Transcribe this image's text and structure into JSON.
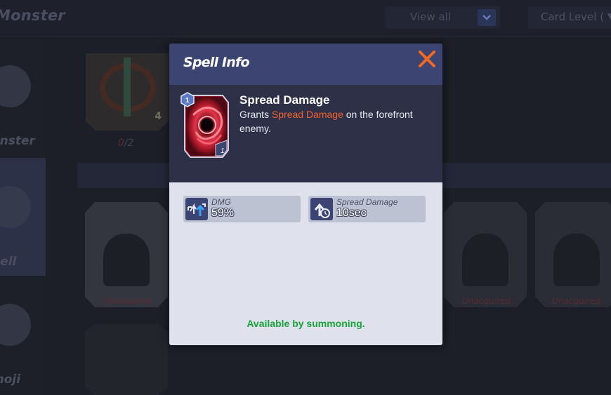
{
  "background": {
    "top_title": "Monster",
    "filter": {
      "selected": "View all"
    },
    "sort": {
      "selected": "Card Level ( ▼"
    },
    "sidebar_items": [
      {
        "label": "onster"
      },
      {
        "label": "pell"
      },
      {
        "label": "moji"
      }
    ],
    "card_progress": {
      "current": "0",
      "separator": "/",
      "total": "2"
    },
    "card_top_count": "4",
    "unacquired_label": "Unacquired"
  },
  "modal": {
    "title": "Spell Info",
    "close_icon": "close-x-icon",
    "spell": {
      "name": "Spread Damage",
      "level_badge": "1",
      "count": "1",
      "description_prefix": "Grants ",
      "description_highlight": "Spread Damage",
      "description_suffix": " on the forefront enemy."
    },
    "stats": [
      {
        "icon": "damage-arrows-icon",
        "label": "DMG",
        "value": "59%"
      },
      {
        "icon": "spread-timer-icon",
        "label": "Spread Damage",
        "value": "10sec"
      }
    ],
    "availability": "Available by summoning."
  },
  "colors": {
    "header": "#3c4572",
    "info_panel": "#2d3046",
    "body": "#dfe2ec",
    "highlight": "#f06330",
    "close": "#f06a23",
    "availability": "#19a43a"
  }
}
